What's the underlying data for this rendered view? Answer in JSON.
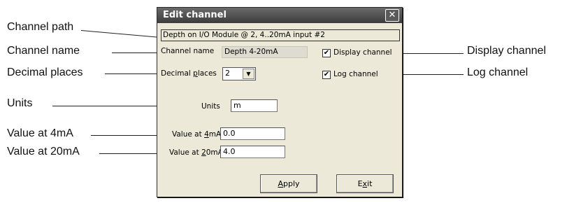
{
  "callouts": {
    "channel_path": "Channel path",
    "channel_name": "Channel name",
    "decimal_places": "Decimal places",
    "units": "Units",
    "value_4ma": "Value at 4mA",
    "value_20ma": "Value at 20mA",
    "display_channel": "Display channel",
    "log_channel": "Log channel"
  },
  "dialog": {
    "title": "Edit channel",
    "close_glyph": "✕",
    "channel_path": "Depth on I/O Module @ 2, 4..20mA input #2",
    "channel_name_label": "Channel name",
    "channel_name_value": "Depth 4-20mA",
    "decimal_places_label_pre": "Decimal ",
    "decimal_places_label_u": "p",
    "decimal_places_label_post": "laces",
    "decimal_places_value": "2",
    "dropdown_glyph": "▼",
    "units_label": "Units",
    "units_value": "m",
    "value_4ma_label_pre": "Value at ",
    "value_4ma_label_u": "4",
    "value_4ma_label_post": "mA",
    "value_4ma_value": "0.0",
    "value_20ma_label_pre": "Value at ",
    "value_20ma_label_u": "2",
    "value_20ma_label_post": "0mA",
    "value_20ma_value": "4.0",
    "display_channel_label": "Display channel",
    "display_channel_checked": true,
    "log_channel_label": "Log channel",
    "log_channel_checked": true,
    "checkmark_glyph": "✔",
    "apply_pre": "",
    "apply_u": "A",
    "apply_post": "pply",
    "exit_pre": "E",
    "exit_u": "x",
    "exit_post": "it"
  }
}
